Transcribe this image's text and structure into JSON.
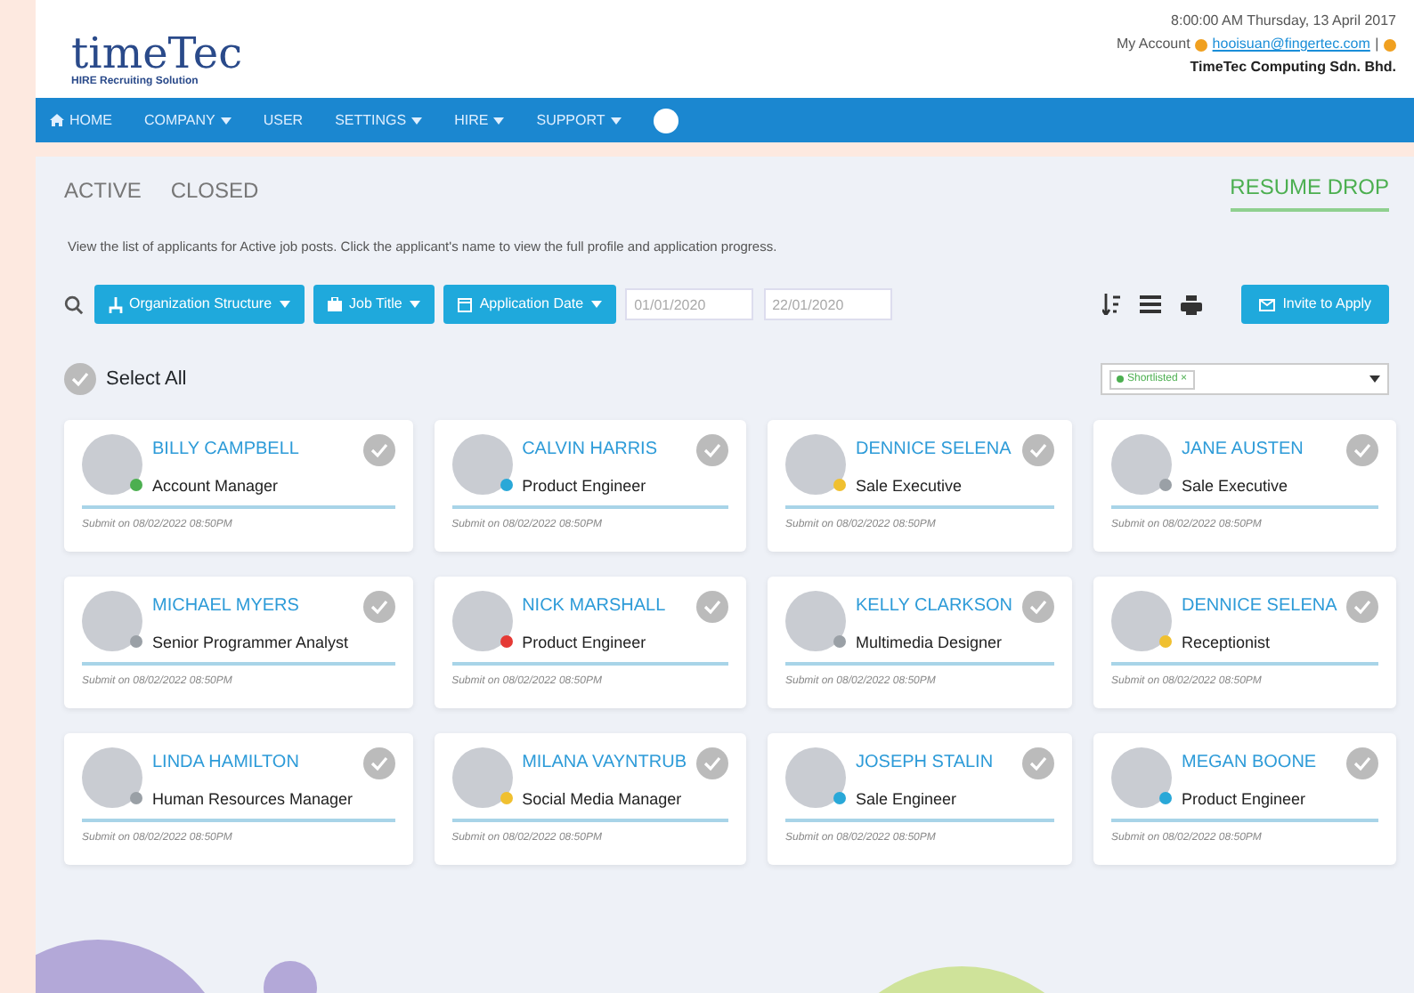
{
  "header": {
    "logo": "timeTec",
    "logo_sub": "HIRE Recruiting Solution",
    "datetime": "8:00:00 AM Thursday, 13 April 2017",
    "account_label": "My Account",
    "email": "hooisuan@fingertec.com",
    "separator": "|",
    "company": "TimeTec Computing Sdn. Bhd."
  },
  "nav": [
    {
      "label": "HOME",
      "dropdown": false
    },
    {
      "label": "COMPANY",
      "dropdown": true
    },
    {
      "label": "USER",
      "dropdown": false
    },
    {
      "label": "SETTINGS",
      "dropdown": true
    },
    {
      "label": "HIRE",
      "dropdown": true
    },
    {
      "label": "SUPPORT",
      "dropdown": true
    }
  ],
  "tabs": [
    {
      "label": "ACTIVE",
      "selected": false
    },
    {
      "label": "CLOSED",
      "selected": false
    },
    {
      "label": "RESUME DROP",
      "selected": true
    }
  ],
  "description": "View the list of applicants for Active job posts. Click the applicant's name to view the full profile and application progress.",
  "filters": [
    {
      "label": "Organization Structure"
    },
    {
      "label": "Job Title"
    },
    {
      "label": "Application Date"
    }
  ],
  "date_from": "01/01/2020",
  "date_to": "22/01/2020",
  "invite_button": "Invite to Apply",
  "select_all": "Select All",
  "status_filter": {
    "tag": "Shortlisted",
    "remove": "×"
  },
  "applicants": [
    {
      "name": "BILLY CAMPBELL",
      "role": "Account Manager",
      "submitted": "Submit on 08/02/2022 08:50PM",
      "color": "#4caf50"
    },
    {
      "name": "CALVIN HARRIS",
      "role": "Product Engineer",
      "submitted": "Submit on 08/02/2022 08:50PM",
      "color": "#29a8d8"
    },
    {
      "name": "DENNICE SELENA",
      "role": "Sale Executive",
      "submitted": "Submit on 08/02/2022 08:50PM",
      "color": "#f0c030"
    },
    {
      "name": "JANE AUSTEN",
      "role": "Sale Executive",
      "submitted": "Submit on 08/02/2022 08:50PM",
      "color": "#9aa0a6"
    },
    {
      "name": "MICHAEL MYERS",
      "role": "Senior Programmer Analyst",
      "submitted": "Submit on 08/02/2022 08:50PM",
      "color": "#9aa0a6"
    },
    {
      "name": "NICK MARSHALL",
      "role": "Product Engineer",
      "submitted": "Submit on 08/02/2022 08:50PM",
      "color": "#e53935"
    },
    {
      "name": "KELLY CLARKSON",
      "role": "Multimedia Designer",
      "submitted": "Submit on 08/02/2022 08:50PM",
      "color": "#9aa0a6"
    },
    {
      "name": "DENNICE SELENA",
      "role": "Receptionist",
      "submitted": "Submit on 08/02/2022 08:50PM",
      "color": "#f0c030"
    },
    {
      "name": "LINDA HAMILTON",
      "role": "Human Resources Manager",
      "submitted": "Submit on 08/02/2022 08:50PM",
      "color": "#9aa0a6"
    },
    {
      "name": "MILANA VAYNTRUB",
      "role": "Social Media Manager",
      "submitted": "Submit on 08/02/2022 08:50PM",
      "color": "#f0c030"
    },
    {
      "name": "JOSEPH STALIN",
      "role": "Sale Engineer",
      "submitted": "Submit on 08/02/2022 08:50PM",
      "color": "#29a8d8"
    },
    {
      "name": "MEGAN BOONE",
      "role": "Product Engineer",
      "submitted": "Submit on 08/02/2022 08:50PM",
      "color": "#29a8d8"
    }
  ]
}
